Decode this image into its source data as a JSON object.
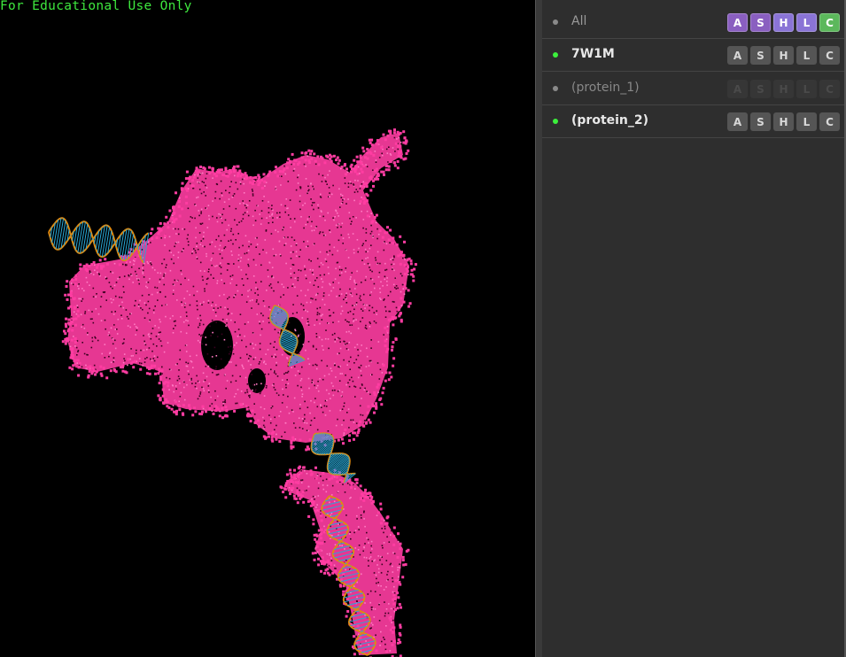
{
  "viewer": {
    "watermark": "For Educational Use Only",
    "background": "#000000",
    "watermark_color": "#3ee83e",
    "protein_color": "#ff3da2",
    "dna_backbone_color": "#e08a10",
    "dna_base_color": "#28a8d6"
  },
  "panel": {
    "rows": [
      {
        "label": "All",
        "label_color": "#9a9a9a",
        "bold": false,
        "dot_color": "#8a8a8a",
        "buttons": [
          {
            "text": "A",
            "bg": "#8a5fc0",
            "fg": "#ffffff",
            "state": "on"
          },
          {
            "text": "S",
            "bg": "#8a5fc0",
            "fg": "#ffffff",
            "state": "on"
          },
          {
            "text": "H",
            "bg": "#8a74d6",
            "fg": "#ffffff",
            "state": "on"
          },
          {
            "text": "L",
            "bg": "#8a74d6",
            "fg": "#ffffff",
            "state": "on"
          },
          {
            "text": "C",
            "bg": "#5cb85c",
            "fg": "#ffffff",
            "state": "on"
          }
        ]
      },
      {
        "label": "7W1M",
        "label_color": "#e8e8e8",
        "bold": true,
        "dot_color": "#3cf03c",
        "buttons": [
          {
            "text": "A",
            "bg": "#555555",
            "fg": "#d8d8d8",
            "state": "off"
          },
          {
            "text": "S",
            "bg": "#555555",
            "fg": "#d8d8d8",
            "state": "off"
          },
          {
            "text": "H",
            "bg": "#555555",
            "fg": "#d8d8d8",
            "state": "off"
          },
          {
            "text": "L",
            "bg": "#555555",
            "fg": "#d8d8d8",
            "state": "off"
          },
          {
            "text": "C",
            "bg": "#555555",
            "fg": "#d8d8d8",
            "state": "off"
          }
        ]
      },
      {
        "label": "(protein_1)",
        "label_color": "#888888",
        "bold": false,
        "dot_color": "#8a8a8a",
        "buttons": [
          {
            "text": "A",
            "bg": "#363636",
            "fg": "#4a4a4a",
            "state": "disabled"
          },
          {
            "text": "S",
            "bg": "#363636",
            "fg": "#4a4a4a",
            "state": "disabled"
          },
          {
            "text": "H",
            "bg": "#363636",
            "fg": "#4a4a4a",
            "state": "disabled"
          },
          {
            "text": "L",
            "bg": "#363636",
            "fg": "#4a4a4a",
            "state": "disabled"
          },
          {
            "text": "C",
            "bg": "#363636",
            "fg": "#4a4a4a",
            "state": "disabled"
          }
        ]
      },
      {
        "label": "(protein_2)",
        "label_color": "#e8e8e8",
        "bold": true,
        "dot_color": "#3cf03c",
        "buttons": [
          {
            "text": "A",
            "bg": "#555555",
            "fg": "#d8d8d8",
            "state": "off"
          },
          {
            "text": "S",
            "bg": "#555555",
            "fg": "#d8d8d8",
            "state": "off"
          },
          {
            "text": "H",
            "bg": "#555555",
            "fg": "#d8d8d8",
            "state": "off"
          },
          {
            "text": "L",
            "bg": "#555555",
            "fg": "#d8d8d8",
            "state": "off"
          },
          {
            "text": "C",
            "bg": "#555555",
            "fg": "#d8d8d8",
            "state": "off"
          }
        ]
      }
    ]
  }
}
